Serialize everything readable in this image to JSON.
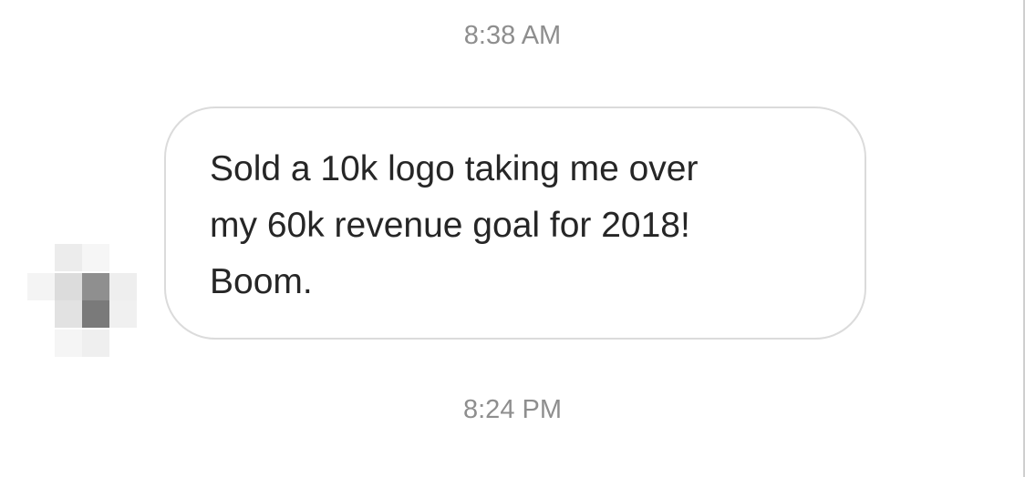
{
  "conversation": {
    "timestamp_top": "8:38 AM",
    "message": {
      "text": "Sold a 10k logo taking me over\nmy 60k revenue goal for 2018!\nBoom."
    },
    "timestamp_bottom": "8:24 PM"
  },
  "colors": {
    "timestamp": "#8e8e8e",
    "bubble_border": "#dbdbdb",
    "message_text": "#262626"
  }
}
